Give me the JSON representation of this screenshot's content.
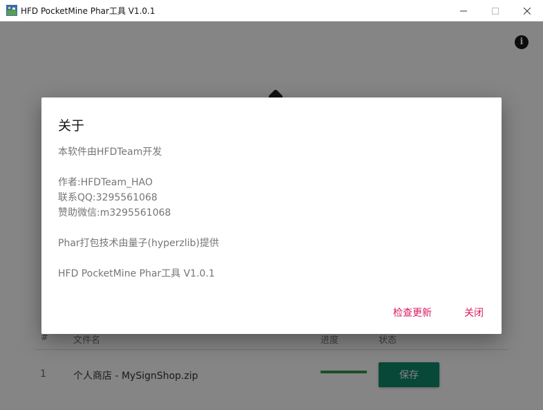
{
  "window": {
    "title": "HFD PocketMine Phar工具 V1.0.1",
    "minimize_glyph": "—",
    "maximize_glyph": "☐",
    "close_glyph": "✕"
  },
  "header": {
    "info_icon_glyph": "i"
  },
  "table": {
    "columns": [
      "#",
      "文件名",
      "进度",
      "状态"
    ],
    "rows": [
      {
        "index": "1",
        "filename": "个人商店 - MySignShop.zip",
        "progress": 1.0,
        "action_label": "保存"
      }
    ]
  },
  "dialog": {
    "title": "关于",
    "lines": [
      "本软件由HFDTeam开发",
      "",
      "作者:HFDTeam_HAO",
      "联系QQ:3295561068",
      "赞助微信:m3295561068",
      "",
      "Phar打包技术由量子(hyperzlib)提供",
      "",
      "HFD PocketMine Phar工具 V1.0.1"
    ],
    "check_update_label": "检查更新",
    "close_label": "关闭"
  },
  "colors": {
    "accent": "#d81b60",
    "save_button": "#0f8a6e",
    "progress_fill": "#2e9a4a"
  }
}
